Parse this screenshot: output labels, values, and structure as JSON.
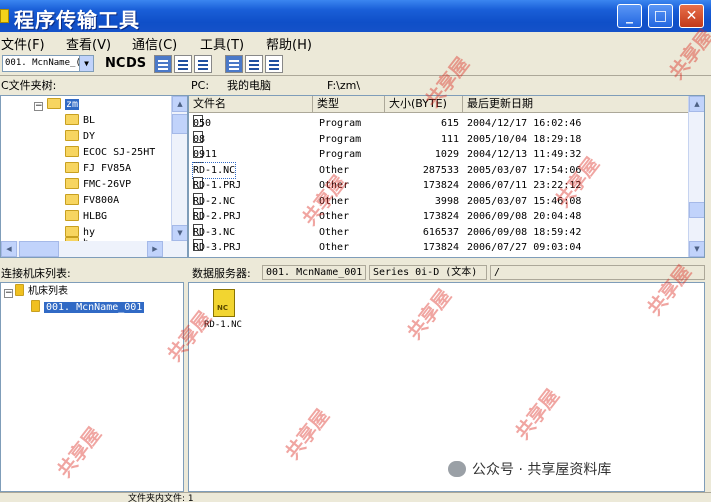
{
  "window": {
    "title": "程序传输工具",
    "min": "_",
    "max": "□",
    "close": "✕"
  },
  "menu": [
    {
      "label": "文件(F)"
    },
    {
      "label": "查看(V)"
    },
    {
      "label": "通信(C)"
    },
    {
      "label": "工具(T)"
    },
    {
      "label": "帮助(H)"
    }
  ],
  "toolbar": {
    "machine_select": "001. McnName_(",
    "nc_label": "NC",
    "ds_label": "DS"
  },
  "left_pane": {
    "header": "C文件夹树:",
    "root": "zm",
    "folders": [
      "BL",
      "DY",
      "ECOC SJ-25HT",
      "FJ FV85A",
      "FMC-26VP",
      "FV800A",
      "HLBG",
      "hy",
      "h"
    ]
  },
  "file_pane": {
    "pc_label": "PC:",
    "pc_name": "我的电脑",
    "path": "F:\\zm\\",
    "columns": [
      "文件名",
      "类型",
      "大小(BYTE)",
      "最后更新日期"
    ],
    "files": [
      {
        "name": "050",
        "type": "Program",
        "size": "615",
        "date": "2004/12/17 16:02:46"
      },
      {
        "name": "08",
        "type": "Program",
        "size": "111",
        "date": "2005/10/04 18:29:18"
      },
      {
        "name": "0911",
        "type": "Program",
        "size": "1029",
        "date": "2004/12/13 11:49:32"
      },
      {
        "name": "RD-1.NC",
        "type": "Other",
        "size": "287533",
        "date": "2005/03/07 17:54:06"
      },
      {
        "name": "RD-1.PRJ",
        "type": "Other",
        "size": "173824",
        "date": "2006/07/11 23:22:12"
      },
      {
        "name": "RD-2.NC",
        "type": "Other",
        "size": "3998",
        "date": "2005/03/07 15:46:08"
      },
      {
        "name": "RD-2.PRJ",
        "type": "Other",
        "size": "173824",
        "date": "2006/09/08 20:04:48"
      },
      {
        "name": "RD-3.NC",
        "type": "Other",
        "size": "616537",
        "date": "2006/09/08 18:59:42"
      },
      {
        "name": "RD-3.PRJ",
        "type": "Other",
        "size": "173824",
        "date": "2006/07/27 09:03:04"
      }
    ]
  },
  "machine_pane": {
    "header": "连接机床列表:",
    "root": "机床列表",
    "item": "001. McnName_001"
  },
  "server_pane": {
    "label": "数据服务器:",
    "machine": "001. McnName_001",
    "series": "Series 0i-D (文本)",
    "path": "/",
    "file_name": "RD-1.NC",
    "file_badge": "NC"
  },
  "status": {
    "text": "文件夹内文件: 1"
  },
  "watermark": "共享屋",
  "wechat": "公众号 · 共享屋资料库",
  "colors": {
    "title_bar": "#0f4fc8",
    "selection": "#316ac5",
    "watermark": "#dc281e"
  }
}
